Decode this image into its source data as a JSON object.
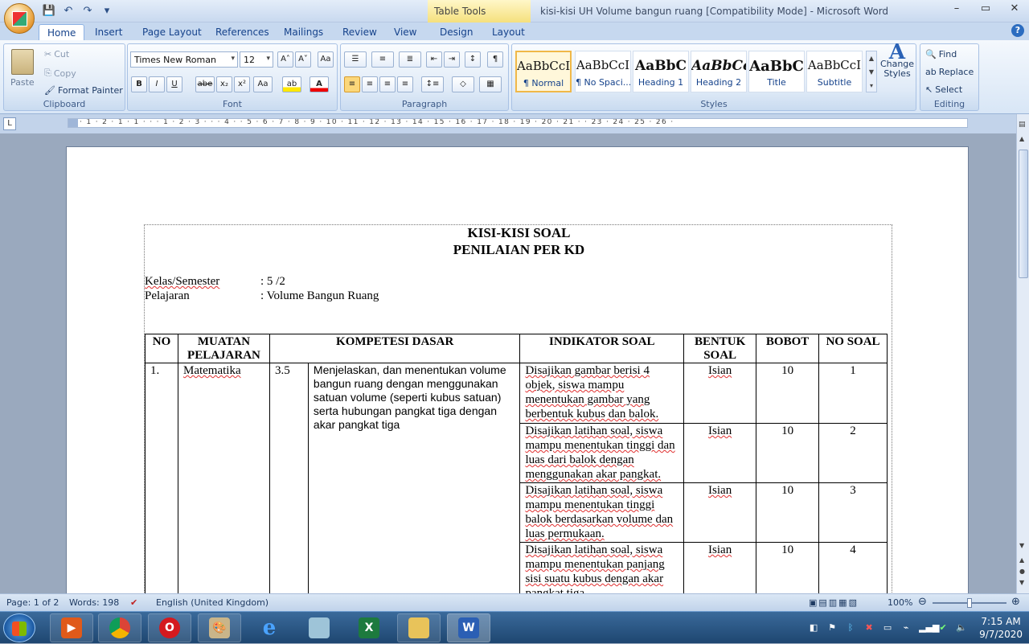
{
  "window": {
    "title": "kisi-kisi UH Volume bangun ruang [Compatibility Mode] - Microsoft Word",
    "contextual_tab_group": "Table Tools",
    "controls": [
      "–",
      "▭",
      "✕"
    ]
  },
  "tabs": [
    "Home",
    "Insert",
    "Page Layout",
    "References",
    "Mailings",
    "Review",
    "View",
    "Design",
    "Layout"
  ],
  "ribbon": {
    "clipboard": {
      "label": "Clipboard",
      "paste": "Paste",
      "cut": "Cut",
      "copy": "Copy",
      "format_painter": "Format Painter"
    },
    "font": {
      "label": "Font",
      "family": "Times New Roman",
      "size": "12",
      "buttons": [
        "B",
        "I",
        "U",
        "abe",
        "x₂",
        "x²",
        "Aa"
      ]
    },
    "paragraph": {
      "label": "Paragraph"
    },
    "styles": {
      "label": "Styles",
      "change_styles": "Change Styles",
      "items": [
        {
          "preview": "AaBbCcI",
          "name": "¶ Normal"
        },
        {
          "preview": "AaBbCcI",
          "name": "¶ No Spaci..."
        },
        {
          "preview": "AaBbC",
          "name": "Heading 1"
        },
        {
          "preview": "AaBbCc",
          "name": "Heading 2"
        },
        {
          "preview": "AaBbC",
          "name": "Title"
        },
        {
          "preview": "AaBbCcI",
          "name": "Subtitle"
        }
      ]
    },
    "editing": {
      "label": "Editing",
      "find": "Find",
      "replace": "Replace",
      "select": "Select"
    }
  },
  "ruler_text": "· 1 · 2 · 1 · 1 · · · 1 · 2 · 3 · · · 4 · · 5 · 6 · 7 · 8 · 9 · 10 · 11 · 12 · 13 · 14 · 15 · 16 · 17 · 18 · 19 · 20 · 21 · · 23 · 24 · 25 · 26 ·",
  "document": {
    "title_1": "KISI-KISI SOAL",
    "title_2": "PENILAIAN PER KD",
    "kelas_label": "Kelas/Semester",
    "kelas_value": ": 5 /2",
    "pelajaran_label": "Pelajaran",
    "pelajaran_value": ": Volume Bangun Ruang",
    "table": {
      "headers": [
        "NO",
        "MUATAN PELAJARAN",
        "KOMPETESI DASAR",
        "INDIKATOR SOAL",
        "BENTUK SOAL",
        "BOBOT",
        "NO SOAL"
      ],
      "no": "1.",
      "muatan": "Matematika",
      "kd_no": "3.5",
      "kd_text": "Menjelaskan, dan menentukan volume bangun ruang dengan menggunakan satuan volume (seperti kubus satuan) serta hubungan pangkat tiga dengan akar pangkat tiga",
      "rows": [
        {
          "indikator": "Disajikan gambar berisi 4 objek, siswa mampu menentukan gambar yang berbentuk kubus dan balok.",
          "bentuk": "Isian",
          "bobot": "10",
          "no_soal": "1"
        },
        {
          "indikator": "Disajikan latihan soal, siswa mampu menentukan tinggi dan luas dari balok dengan menggunakan akar pangkat.",
          "bentuk": "Isian",
          "bobot": "10",
          "no_soal": "2"
        },
        {
          "indikator": "Disajikan latihan soal, siswa mampu menentukan tinggi balok berdasarkan volume dan luas permukaan.",
          "bentuk": "Isian",
          "bobot": "10",
          "no_soal": "3"
        },
        {
          "indikator": "Disajikan latihan soal, siswa mampu menentukan panjang sisi suatu kubus dengan akar pangkat tiga.",
          "bentuk": "Isian",
          "bobot": "10",
          "no_soal": "4"
        }
      ]
    }
  },
  "status": {
    "page": "Page: 1 of 2",
    "words": "Words: 198",
    "language": "English (United Kingdom)",
    "zoom": "100%"
  },
  "taskbar": {
    "apps": [
      "media-player",
      "chrome",
      "opera",
      "paint",
      "internet-explorer",
      "notepad",
      "excel",
      "file-explorer",
      "word"
    ],
    "time": "7:15 AM",
    "date": "9/7/2020"
  },
  "colors": {
    "ribbon_text": "#15428b",
    "context_tab": "#f5e07d",
    "taskbar": "#1e4670"
  }
}
